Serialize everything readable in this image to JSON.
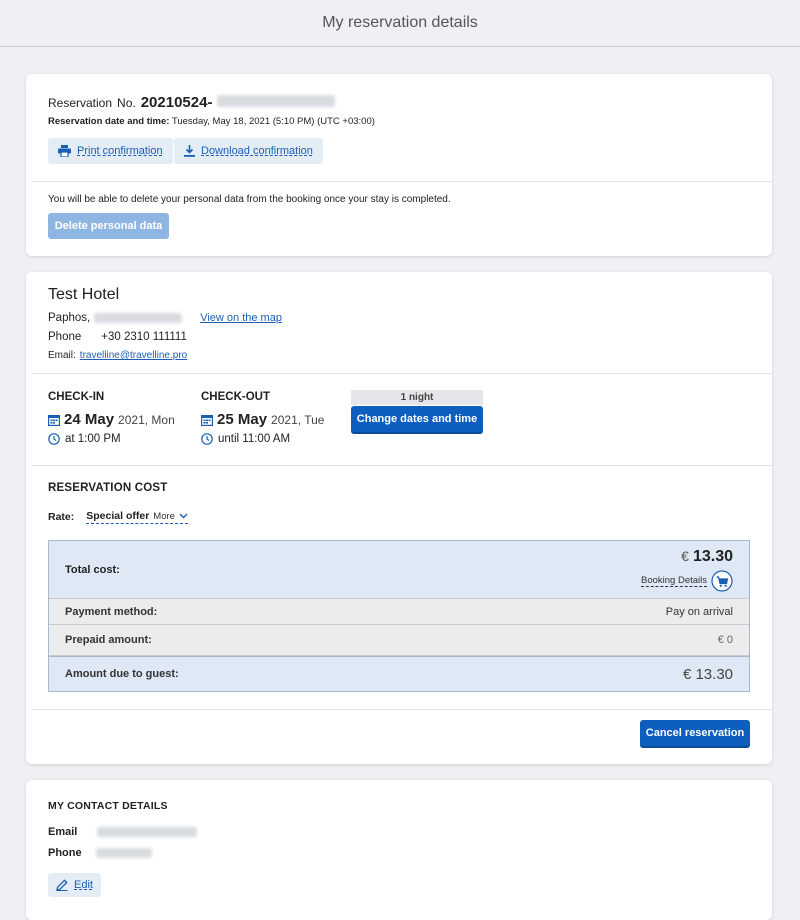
{
  "page": {
    "title": "My reservation details"
  },
  "reservation": {
    "no_label": "Reservation",
    "no_prefix": "No.",
    "number": "20210524-",
    "datetime_label": "Reservation date and time:",
    "datetime_value": "Tuesday, May 18, 2021 (5:10 PM) (UTC +03:00)",
    "print_label": "Print confirmation",
    "download_label": "Download confirmation",
    "delete_note": "You will be able to delete your personal data from the booking once your stay is completed.",
    "delete_label": "Delete personal data"
  },
  "hotel": {
    "name": "Test Hotel",
    "city": "Paphos,",
    "map_link": "View on the map",
    "phone_label": "Phone",
    "phone_value": "+30 2310 111111",
    "email_label": "Email:",
    "email_value": "travelline@travelline.pro"
  },
  "stay": {
    "checkin_label": "CHECK-IN",
    "checkin_date": "24 May",
    "checkin_rest": "2021, Mon",
    "checkin_time": "at 1:00 PM",
    "checkout_label": "CHECK-OUT",
    "checkout_date": "25 May",
    "checkout_rest": "2021, Tue",
    "checkout_time": "until 11:00 AM",
    "nights": "1 night",
    "change_label": "Change dates and time"
  },
  "cost": {
    "heading": "RESERVATION COST",
    "rate_label": "Rate:",
    "rate_value": "Special offer",
    "more_label": "More",
    "total_label": "Total cost:",
    "currency": "€",
    "total_value": "13.30",
    "booking_details": "Booking Details",
    "payment_label": "Payment method:",
    "payment_value": "Pay on arrival",
    "prepaid_label": "Prepaid amount:",
    "prepaid_value": "€ 0",
    "due_label": "Amount due to guest:",
    "due_value": "€ 13.30",
    "cancel_label": "Cancel reservation"
  },
  "contact": {
    "heading": "MY CONTACT DETAILS",
    "email_label": "Email",
    "phone_label": "Phone",
    "edit_label": "Edit"
  },
  "colors": {
    "accent": "#0d5ebf",
    "link": "#1a5fb4",
    "total_bg": "#dfe8f5",
    "row_bg": "#ececec"
  }
}
